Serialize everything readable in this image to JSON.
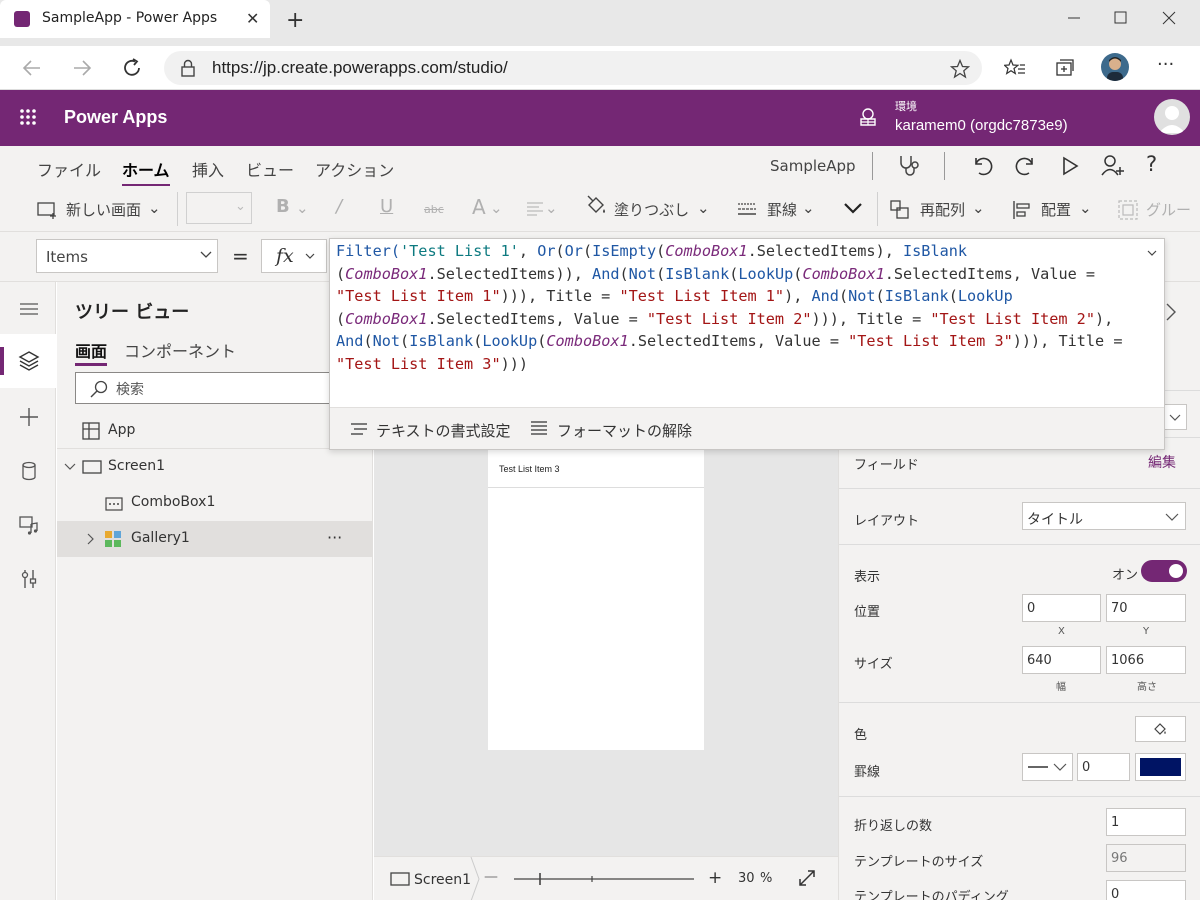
{
  "browser": {
    "tab_title": "SampleApp - Power Apps",
    "url": "https://jp.create.powerapps.com/studio/"
  },
  "header": {
    "brand": "Power Apps",
    "env_label": "環境",
    "env_name": "karamem0 (orgdc7873e9)"
  },
  "menu": {
    "items": [
      "ファイル",
      "ホーム",
      "挿入",
      "ビュー",
      "アクション"
    ],
    "app_name": "SampleApp"
  },
  "ribbon": {
    "new_screen": "新しい画面",
    "fill": "塗りつぶし",
    "border": "罫線",
    "reorder": "再配列",
    "align": "配置",
    "group": "グルー"
  },
  "formula": {
    "property": "Items",
    "equals": "=",
    "fx": "fx",
    "format_text": "テキストの書式設定",
    "remove_format": "フォーマットの解除",
    "code": {
      "t01": "Filter(",
      "t02": "'Test List 1'",
      "t03": ", ",
      "t04": "Or",
      "t05": "(",
      "t06": "Or",
      "t07": "(",
      "t08": "IsEmpty",
      "t09": "(",
      "t10": "ComboBox1",
      "t11": ".SelectedItems), ",
      "t12": "IsBlank",
      "t13": "\n(",
      "t14": "ComboBox1",
      "t15": ".SelectedItems)), ",
      "t16": "And",
      "t17": "(",
      "t18": "Not",
      "t19": "(",
      "t20": "IsBlank",
      "t21": "(",
      "t22": "LookUp",
      "t23": "(",
      "t24": "ComboBox1",
      "t25": ".SelectedItems, Value =\n",
      "t26": "\"Test List Item 1\"",
      "t27": "))), Title = ",
      "t28": "\"Test List Item 1\"",
      "t29": "), ",
      "t30": "And",
      "t31": "(",
      "t32": "Not",
      "t33": "(",
      "t34": "IsBlank",
      "t35": "(",
      "t36": "LookUp",
      "t37": "\n(",
      "t38": "ComboBox1",
      "t39": ".SelectedItems, Value = ",
      "t40": "\"Test List Item 2\"",
      "t41": "))), Title = ",
      "t42": "\"Test List Item 2\"",
      "t43": "),\n",
      "t44": "And",
      "t45": "(",
      "t46": "Not",
      "t47": "(",
      "t48": "IsBlank",
      "t49": "(",
      "t50": "LookUp",
      "t51": "(",
      "t52": "ComboBox1",
      "t53": ".SelectedItems, Value = ",
      "t54": "\"Test List Item 3\"",
      "t55": "))), Title =\n",
      "t56": "\"Test List Item 3\"",
      "t57": ")))"
    }
  },
  "tree": {
    "title": "ツリー ビュー",
    "tab_screens": "画面",
    "tab_components": "コンポーネント",
    "search_placeholder": "検索",
    "nodes": [
      "App",
      "Screen1",
      "ComboBox1",
      "Gallery1"
    ],
    "more": "···"
  },
  "canvas": {
    "gallery_item": "Test List Item 3",
    "screen_tab": "Screen1",
    "zoom_minus": "—",
    "zoom_plus": "+",
    "zoom": "30",
    "zoom_unit": "%"
  },
  "props": {
    "field_label": "フィールド",
    "field_edit": "編集",
    "layout_label": "レイアウト",
    "layout_value": "タイトル",
    "visible_label": "表示",
    "visible_state": "オン",
    "position_label": "位置",
    "x_value": "0",
    "y_value": "70",
    "x_label": "X",
    "y_label": "Y",
    "size_label": "サイズ",
    "width_value": "640",
    "height_value": "1066",
    "width_label": "幅",
    "height_label": "高さ",
    "color_label": "色",
    "border_label": "罫線",
    "border_width": "0",
    "border_color": "#001464",
    "wrap_label": "折り返しの数",
    "wrap_value": "1",
    "template_size_label": "テンプレートのサイズ",
    "template_size_value": "96",
    "template_padding_label": "テンプレートのパディング",
    "template_padding_value": "0"
  },
  "colors": {
    "brand": "#742774",
    "toggle_on": "#742774"
  }
}
